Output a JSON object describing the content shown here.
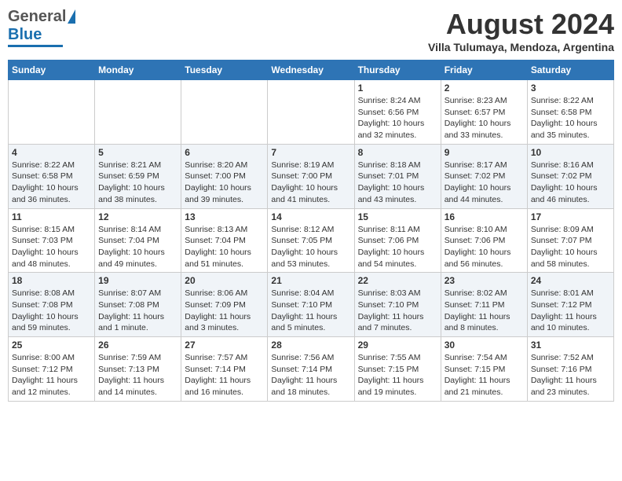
{
  "header": {
    "logo_general": "General",
    "logo_blue": "Blue",
    "main_title": "August 2024",
    "subtitle": "Villa Tulumaya, Mendoza, Argentina"
  },
  "days_of_week": [
    "Sunday",
    "Monday",
    "Tuesday",
    "Wednesday",
    "Thursday",
    "Friday",
    "Saturday"
  ],
  "weeks": [
    [
      {
        "day": "",
        "info": ""
      },
      {
        "day": "",
        "info": ""
      },
      {
        "day": "",
        "info": ""
      },
      {
        "day": "",
        "info": ""
      },
      {
        "day": "1",
        "info": "Sunrise: 8:24 AM\nSunset: 6:56 PM\nDaylight: 10 hours\nand 32 minutes."
      },
      {
        "day": "2",
        "info": "Sunrise: 8:23 AM\nSunset: 6:57 PM\nDaylight: 10 hours\nand 33 minutes."
      },
      {
        "day": "3",
        "info": "Sunrise: 8:22 AM\nSunset: 6:58 PM\nDaylight: 10 hours\nand 35 minutes."
      }
    ],
    [
      {
        "day": "4",
        "info": "Sunrise: 8:22 AM\nSunset: 6:58 PM\nDaylight: 10 hours\nand 36 minutes."
      },
      {
        "day": "5",
        "info": "Sunrise: 8:21 AM\nSunset: 6:59 PM\nDaylight: 10 hours\nand 38 minutes."
      },
      {
        "day": "6",
        "info": "Sunrise: 8:20 AM\nSunset: 7:00 PM\nDaylight: 10 hours\nand 39 minutes."
      },
      {
        "day": "7",
        "info": "Sunrise: 8:19 AM\nSunset: 7:00 PM\nDaylight: 10 hours\nand 41 minutes."
      },
      {
        "day": "8",
        "info": "Sunrise: 8:18 AM\nSunset: 7:01 PM\nDaylight: 10 hours\nand 43 minutes."
      },
      {
        "day": "9",
        "info": "Sunrise: 8:17 AM\nSunset: 7:02 PM\nDaylight: 10 hours\nand 44 minutes."
      },
      {
        "day": "10",
        "info": "Sunrise: 8:16 AM\nSunset: 7:02 PM\nDaylight: 10 hours\nand 46 minutes."
      }
    ],
    [
      {
        "day": "11",
        "info": "Sunrise: 8:15 AM\nSunset: 7:03 PM\nDaylight: 10 hours\nand 48 minutes."
      },
      {
        "day": "12",
        "info": "Sunrise: 8:14 AM\nSunset: 7:04 PM\nDaylight: 10 hours\nand 49 minutes."
      },
      {
        "day": "13",
        "info": "Sunrise: 8:13 AM\nSunset: 7:04 PM\nDaylight: 10 hours\nand 51 minutes."
      },
      {
        "day": "14",
        "info": "Sunrise: 8:12 AM\nSunset: 7:05 PM\nDaylight: 10 hours\nand 53 minutes."
      },
      {
        "day": "15",
        "info": "Sunrise: 8:11 AM\nSunset: 7:06 PM\nDaylight: 10 hours\nand 54 minutes."
      },
      {
        "day": "16",
        "info": "Sunrise: 8:10 AM\nSunset: 7:06 PM\nDaylight: 10 hours\nand 56 minutes."
      },
      {
        "day": "17",
        "info": "Sunrise: 8:09 AM\nSunset: 7:07 PM\nDaylight: 10 hours\nand 58 minutes."
      }
    ],
    [
      {
        "day": "18",
        "info": "Sunrise: 8:08 AM\nSunset: 7:08 PM\nDaylight: 10 hours\nand 59 minutes."
      },
      {
        "day": "19",
        "info": "Sunrise: 8:07 AM\nSunset: 7:08 PM\nDaylight: 11 hours\nand 1 minute."
      },
      {
        "day": "20",
        "info": "Sunrise: 8:06 AM\nSunset: 7:09 PM\nDaylight: 11 hours\nand 3 minutes."
      },
      {
        "day": "21",
        "info": "Sunrise: 8:04 AM\nSunset: 7:10 PM\nDaylight: 11 hours\nand 5 minutes."
      },
      {
        "day": "22",
        "info": "Sunrise: 8:03 AM\nSunset: 7:10 PM\nDaylight: 11 hours\nand 7 minutes."
      },
      {
        "day": "23",
        "info": "Sunrise: 8:02 AM\nSunset: 7:11 PM\nDaylight: 11 hours\nand 8 minutes."
      },
      {
        "day": "24",
        "info": "Sunrise: 8:01 AM\nSunset: 7:12 PM\nDaylight: 11 hours\nand 10 minutes."
      }
    ],
    [
      {
        "day": "25",
        "info": "Sunrise: 8:00 AM\nSunset: 7:12 PM\nDaylight: 11 hours\nand 12 minutes."
      },
      {
        "day": "26",
        "info": "Sunrise: 7:59 AM\nSunset: 7:13 PM\nDaylight: 11 hours\nand 14 minutes."
      },
      {
        "day": "27",
        "info": "Sunrise: 7:57 AM\nSunset: 7:14 PM\nDaylight: 11 hours\nand 16 minutes."
      },
      {
        "day": "28",
        "info": "Sunrise: 7:56 AM\nSunset: 7:14 PM\nDaylight: 11 hours\nand 18 minutes."
      },
      {
        "day": "29",
        "info": "Sunrise: 7:55 AM\nSunset: 7:15 PM\nDaylight: 11 hours\nand 19 minutes."
      },
      {
        "day": "30",
        "info": "Sunrise: 7:54 AM\nSunset: 7:15 PM\nDaylight: 11 hours\nand 21 minutes."
      },
      {
        "day": "31",
        "info": "Sunrise: 7:52 AM\nSunset: 7:16 PM\nDaylight: 11 hours\nand 23 minutes."
      }
    ]
  ]
}
